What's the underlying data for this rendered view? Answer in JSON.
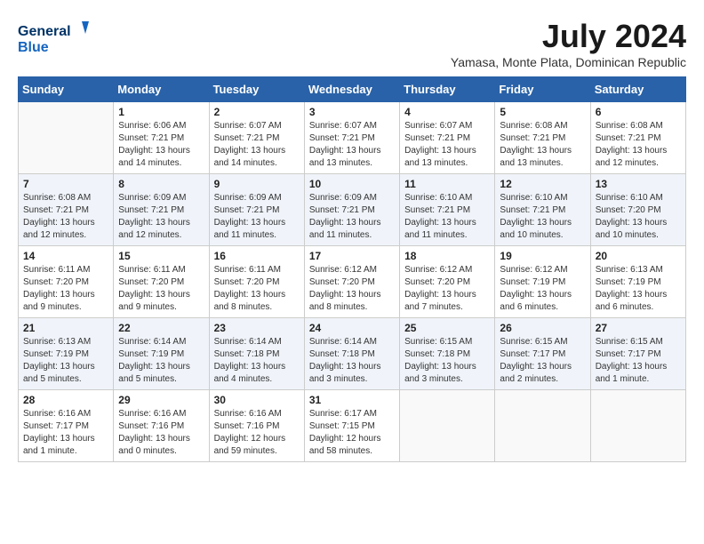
{
  "logo": {
    "line1": "General",
    "line2": "Blue"
  },
  "title": {
    "month_year": "July 2024",
    "location": "Yamasa, Monte Plata, Dominican Republic"
  },
  "headers": [
    "Sunday",
    "Monday",
    "Tuesday",
    "Wednesday",
    "Thursday",
    "Friday",
    "Saturday"
  ],
  "weeks": [
    [
      {
        "day": "",
        "info": ""
      },
      {
        "day": "1",
        "info": "Sunrise: 6:06 AM\nSunset: 7:21 PM\nDaylight: 13 hours\nand 14 minutes."
      },
      {
        "day": "2",
        "info": "Sunrise: 6:07 AM\nSunset: 7:21 PM\nDaylight: 13 hours\nand 14 minutes."
      },
      {
        "day": "3",
        "info": "Sunrise: 6:07 AM\nSunset: 7:21 PM\nDaylight: 13 hours\nand 13 minutes."
      },
      {
        "day": "4",
        "info": "Sunrise: 6:07 AM\nSunset: 7:21 PM\nDaylight: 13 hours\nand 13 minutes."
      },
      {
        "day": "5",
        "info": "Sunrise: 6:08 AM\nSunset: 7:21 PM\nDaylight: 13 hours\nand 13 minutes."
      },
      {
        "day": "6",
        "info": "Sunrise: 6:08 AM\nSunset: 7:21 PM\nDaylight: 13 hours\nand 12 minutes."
      }
    ],
    [
      {
        "day": "7",
        "info": "Sunrise: 6:08 AM\nSunset: 7:21 PM\nDaylight: 13 hours\nand 12 minutes."
      },
      {
        "day": "8",
        "info": "Sunrise: 6:09 AM\nSunset: 7:21 PM\nDaylight: 13 hours\nand 12 minutes."
      },
      {
        "day": "9",
        "info": "Sunrise: 6:09 AM\nSunset: 7:21 PM\nDaylight: 13 hours\nand 11 minutes."
      },
      {
        "day": "10",
        "info": "Sunrise: 6:09 AM\nSunset: 7:21 PM\nDaylight: 13 hours\nand 11 minutes."
      },
      {
        "day": "11",
        "info": "Sunrise: 6:10 AM\nSunset: 7:21 PM\nDaylight: 13 hours\nand 11 minutes."
      },
      {
        "day": "12",
        "info": "Sunrise: 6:10 AM\nSunset: 7:21 PM\nDaylight: 13 hours\nand 10 minutes."
      },
      {
        "day": "13",
        "info": "Sunrise: 6:10 AM\nSunset: 7:20 PM\nDaylight: 13 hours\nand 10 minutes."
      }
    ],
    [
      {
        "day": "14",
        "info": "Sunrise: 6:11 AM\nSunset: 7:20 PM\nDaylight: 13 hours\nand 9 minutes."
      },
      {
        "day": "15",
        "info": "Sunrise: 6:11 AM\nSunset: 7:20 PM\nDaylight: 13 hours\nand 9 minutes."
      },
      {
        "day": "16",
        "info": "Sunrise: 6:11 AM\nSunset: 7:20 PM\nDaylight: 13 hours\nand 8 minutes."
      },
      {
        "day": "17",
        "info": "Sunrise: 6:12 AM\nSunset: 7:20 PM\nDaylight: 13 hours\nand 8 minutes."
      },
      {
        "day": "18",
        "info": "Sunrise: 6:12 AM\nSunset: 7:20 PM\nDaylight: 13 hours\nand 7 minutes."
      },
      {
        "day": "19",
        "info": "Sunrise: 6:12 AM\nSunset: 7:19 PM\nDaylight: 13 hours\nand 6 minutes."
      },
      {
        "day": "20",
        "info": "Sunrise: 6:13 AM\nSunset: 7:19 PM\nDaylight: 13 hours\nand 6 minutes."
      }
    ],
    [
      {
        "day": "21",
        "info": "Sunrise: 6:13 AM\nSunset: 7:19 PM\nDaylight: 13 hours\nand 5 minutes."
      },
      {
        "day": "22",
        "info": "Sunrise: 6:14 AM\nSunset: 7:19 PM\nDaylight: 13 hours\nand 5 minutes."
      },
      {
        "day": "23",
        "info": "Sunrise: 6:14 AM\nSunset: 7:18 PM\nDaylight: 13 hours\nand 4 minutes."
      },
      {
        "day": "24",
        "info": "Sunrise: 6:14 AM\nSunset: 7:18 PM\nDaylight: 13 hours\nand 3 minutes."
      },
      {
        "day": "25",
        "info": "Sunrise: 6:15 AM\nSunset: 7:18 PM\nDaylight: 13 hours\nand 3 minutes."
      },
      {
        "day": "26",
        "info": "Sunrise: 6:15 AM\nSunset: 7:17 PM\nDaylight: 13 hours\nand 2 minutes."
      },
      {
        "day": "27",
        "info": "Sunrise: 6:15 AM\nSunset: 7:17 PM\nDaylight: 13 hours\nand 1 minute."
      }
    ],
    [
      {
        "day": "28",
        "info": "Sunrise: 6:16 AM\nSunset: 7:17 PM\nDaylight: 13 hours\nand 1 minute."
      },
      {
        "day": "29",
        "info": "Sunrise: 6:16 AM\nSunset: 7:16 PM\nDaylight: 13 hours\nand 0 minutes."
      },
      {
        "day": "30",
        "info": "Sunrise: 6:16 AM\nSunset: 7:16 PM\nDaylight: 12 hours\nand 59 minutes."
      },
      {
        "day": "31",
        "info": "Sunrise: 6:17 AM\nSunset: 7:15 PM\nDaylight: 12 hours\nand 58 minutes."
      },
      {
        "day": "",
        "info": ""
      },
      {
        "day": "",
        "info": ""
      },
      {
        "day": "",
        "info": ""
      }
    ]
  ]
}
